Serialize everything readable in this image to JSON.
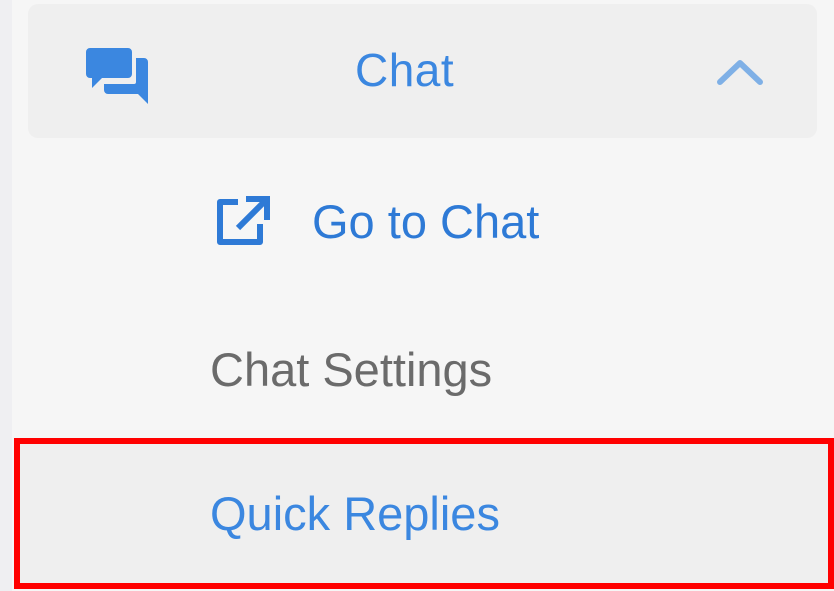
{
  "menu": {
    "header": {
      "label": "Chat",
      "icon": "chat-bubbles-icon",
      "expand_icon": "chevron-up-icon"
    },
    "items": [
      {
        "label": "Go to Chat",
        "icon": "external-link-icon"
      },
      {
        "label": "Chat Settings"
      },
      {
        "label": "Quick Replies",
        "highlighted": true
      }
    ]
  },
  "colors": {
    "accent": "#3b87e0",
    "link": "#2e7ad6",
    "muted_text": "#6b6b6b",
    "highlight_border": "#ff0000",
    "header_bg": "#efefef",
    "page_bg": "#f6f6f6"
  }
}
